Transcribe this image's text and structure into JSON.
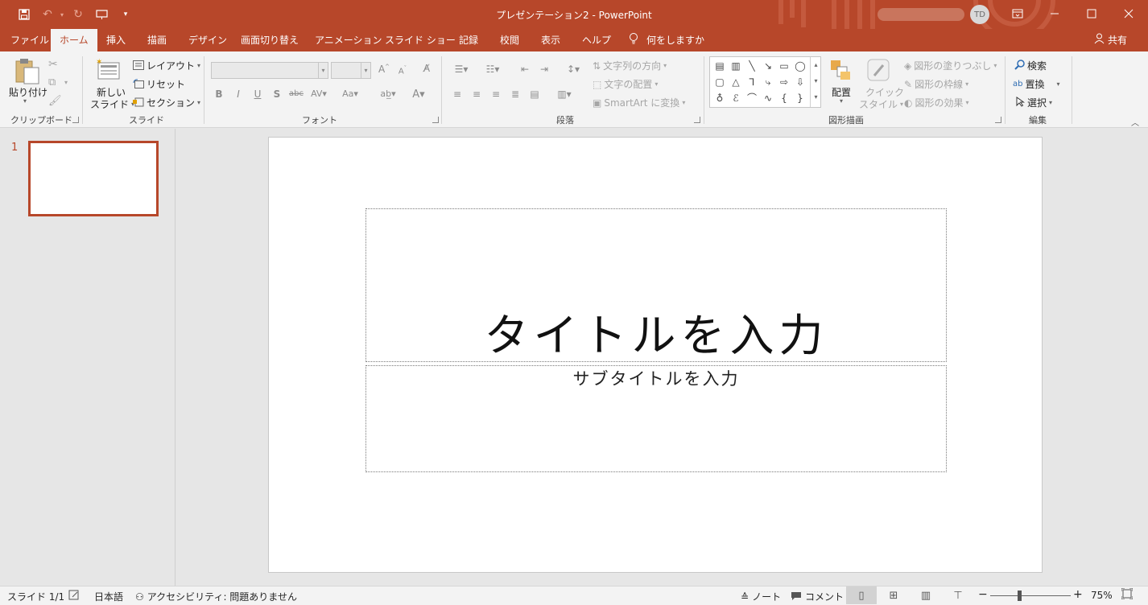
{
  "titlebar": {
    "title": "プレゼンテーション2  -  PowerPoint",
    "avatar_initials": "TD",
    "qat": {
      "save": "save-icon",
      "undo": "undo-icon",
      "redo": "redo-icon",
      "present": "present-icon",
      "customize": "customize-icon"
    },
    "buttons": {
      "ribbon_options": "ribbon-display-icon",
      "minimize": "minimize-icon",
      "maximize": "maximize-icon",
      "close": "close-icon"
    }
  },
  "tabs": [
    "ファイル",
    "ホーム",
    "挿入",
    "描画",
    "デザイン",
    "画面切り替え",
    "アニメーション",
    "スライド ショー",
    "記録",
    "校閲",
    "表示",
    "ヘルプ"
  ],
  "tell_me": "何をしますか",
  "share": "共有",
  "ribbon": {
    "clipboard": {
      "label": "クリップボード",
      "paste": "貼り付け"
    },
    "slides": {
      "label": "スライド",
      "new_slide_1": "新しい",
      "new_slide_2": "スライド",
      "layout": "レイアウト",
      "reset": "リセット",
      "section": "セクション"
    },
    "font": {
      "label": "フォント"
    },
    "paragraph": {
      "label": "段落",
      "text_direction": "文字列の方向",
      "align_text": "文字の配置",
      "smartart": "SmartArt に変換"
    },
    "drawing": {
      "label": "図形描画",
      "arrange": "配置",
      "quick_style_1": "クイック",
      "quick_style_2": "スタイル",
      "fill": "図形の塗りつぶし",
      "outline": "図形の枠線",
      "effects": "図形の効果"
    },
    "editing": {
      "label": "編集",
      "find": "検索",
      "replace": "置換",
      "select": "選択"
    }
  },
  "thumbnail": {
    "number": "1"
  },
  "slide": {
    "title_placeholder": "タイトルを入力",
    "subtitle_placeholder": "サブタイトルを入力"
  },
  "status": {
    "slide": "スライド 1/1",
    "language": "日本語",
    "accessibility": "アクセシビリティ: 問題ありません",
    "notes": "ノート",
    "comments": "コメント",
    "zoom": "75%"
  },
  "colors": {
    "accent": "#b7472a",
    "ribbon_bg": "#f3f3f3",
    "workspace": "#e6e6e6"
  }
}
